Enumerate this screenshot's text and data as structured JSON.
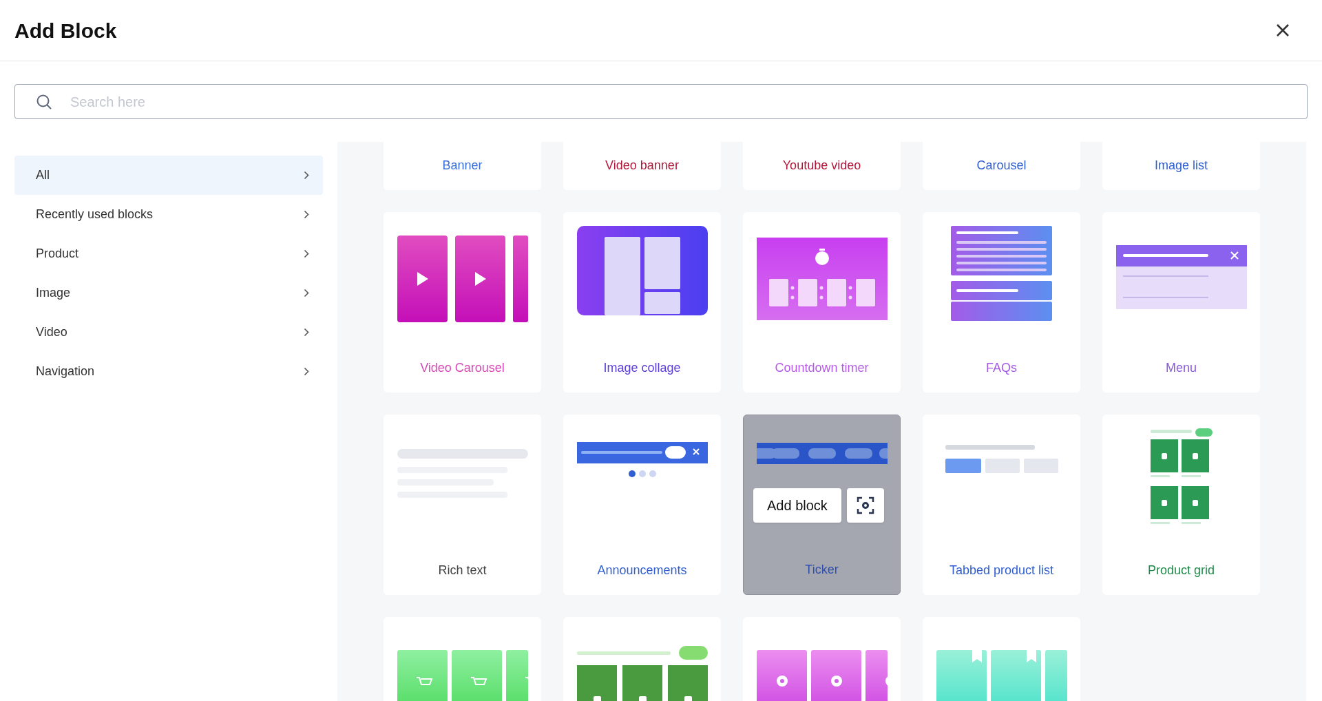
{
  "dialog": {
    "title": "Add Block"
  },
  "search": {
    "placeholder": "Search here"
  },
  "sidebar": {
    "items": [
      {
        "label": "All",
        "selected": true
      },
      {
        "label": "Recently used blocks",
        "selected": false
      },
      {
        "label": "Product",
        "selected": false
      },
      {
        "label": "Image",
        "selected": false
      },
      {
        "label": "Video",
        "selected": false
      },
      {
        "label": "Navigation",
        "selected": false
      }
    ]
  },
  "hover_button": "Add block",
  "blocks": [
    {
      "kind": "hidden",
      "label": "Banner",
      "color": "#3b6fd6",
      "hovered": false
    },
    {
      "kind": "hidden",
      "label": "Video banner",
      "color": "#b0173a",
      "hovered": false
    },
    {
      "kind": "hidden",
      "label": "Youtube video",
      "color": "#b0173a",
      "hovered": false
    },
    {
      "kind": "hidden",
      "label": "Carousel",
      "color": "#2f5fd0",
      "hovered": false
    },
    {
      "kind": "hidden",
      "label": "Image list",
      "color": "#2f5fd0",
      "hovered": false
    },
    {
      "kind": "video_carousel",
      "label": "Video Carousel",
      "color": "#d946b8",
      "hovered": false
    },
    {
      "kind": "image_collage",
      "label": "Image collage",
      "color": "#5b3fd6",
      "hovered": false
    },
    {
      "kind": "countdown",
      "label": "Countdown timer",
      "color": "#b65be8",
      "hovered": false
    },
    {
      "kind": "faqs",
      "label": "FAQs",
      "color": "#a35be8",
      "hovered": false
    },
    {
      "kind": "menu",
      "label": "Menu",
      "color": "#8a5be0",
      "hovered": false
    },
    {
      "kind": "rich_text",
      "label": "Rich text",
      "color": "#444444",
      "hovered": false
    },
    {
      "kind": "announcements",
      "label": "Announcements",
      "color": "#2f5fd0",
      "hovered": false
    },
    {
      "kind": "ticker",
      "label": "Ticker",
      "color": "#2f4fb0",
      "hovered": true
    },
    {
      "kind": "tabbed",
      "label": "Tabbed product list",
      "color": "#2f5fd0",
      "hovered": false
    },
    {
      "kind": "product_grid",
      "label": "Product grid",
      "color": "#1f8a4a",
      "hovered": false
    },
    {
      "kind": "cart_carousel",
      "hovered": false
    },
    {
      "kind": "featured",
      "hovered": false
    },
    {
      "kind": "quick_view",
      "hovered": false
    },
    {
      "kind": "wishlist",
      "hovered": false
    }
  ]
}
